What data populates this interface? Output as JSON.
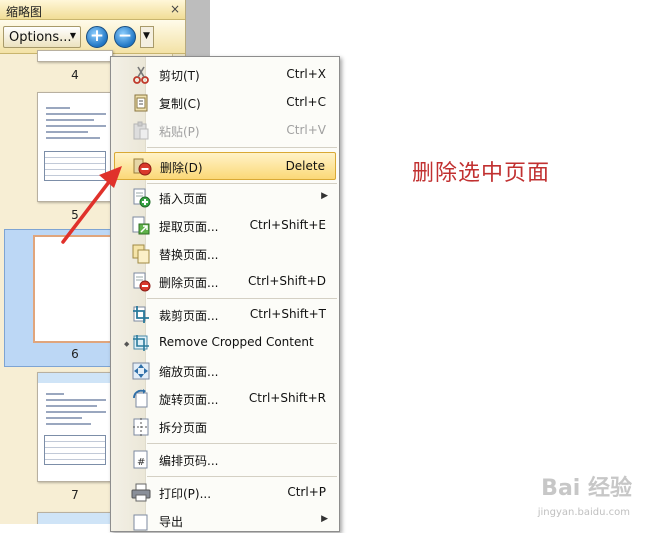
{
  "panel": {
    "title": "缩略图",
    "close": "×",
    "options_label": "Options...",
    "zoom_in": "+",
    "zoom_out": "−"
  },
  "thumbnails": {
    "page_numbers": [
      "4",
      "5",
      "6",
      "7"
    ],
    "selected": "6"
  },
  "menu": {
    "items": [
      {
        "label": "剪切(T)",
        "shortcut": "Ctrl+X",
        "icon": "scissors-icon"
      },
      {
        "label": "复制(C)",
        "shortcut": "Ctrl+C",
        "icon": "copy-icon"
      },
      {
        "label": "粘贴(P)",
        "shortcut": "Ctrl+V",
        "icon": "paste-icon",
        "disabled": true
      },
      {
        "label": "删除(D)",
        "shortcut": "Delete",
        "icon": "delete-icon",
        "highlighted": true
      },
      {
        "label": "插入页面",
        "shortcut": "",
        "icon": "insert-page-icon",
        "submenu": true
      },
      {
        "label": "提取页面...",
        "shortcut": "Ctrl+Shift+E",
        "icon": "extract-page-icon"
      },
      {
        "label": "替换页面...",
        "shortcut": "",
        "icon": "replace-page-icon"
      },
      {
        "label": "删除页面...",
        "shortcut": "Ctrl+Shift+D",
        "icon": "delete-page-icon"
      },
      {
        "label": "裁剪页面...",
        "shortcut": "Ctrl+Shift+T",
        "icon": "crop-page-icon"
      },
      {
        "label": "Remove Cropped Content",
        "shortcut": "",
        "icon": "remove-crop-icon"
      },
      {
        "label": "缩放页面...",
        "shortcut": "",
        "icon": "scale-page-icon"
      },
      {
        "label": "旋转页面...",
        "shortcut": "Ctrl+Shift+R",
        "icon": "rotate-page-icon"
      },
      {
        "label": "拆分页面",
        "shortcut": "",
        "icon": "split-page-icon"
      },
      {
        "label": "编排页码...",
        "shortcut": "",
        "icon": "page-number-icon"
      },
      {
        "label": "打印(P)...",
        "shortcut": "Ctrl+P",
        "icon": "print-icon"
      },
      {
        "label": "导出",
        "shortcut": "",
        "icon": "export-icon",
        "submenu": true
      }
    ]
  },
  "annotation": "删除选中页面",
  "watermark": {
    "text": "Bai 经验",
    "url": "jingyan.baidu.com"
  },
  "colors": {
    "annotation": "#c13030",
    "highlight": "#fbd877",
    "panel": "#f7eed4"
  }
}
